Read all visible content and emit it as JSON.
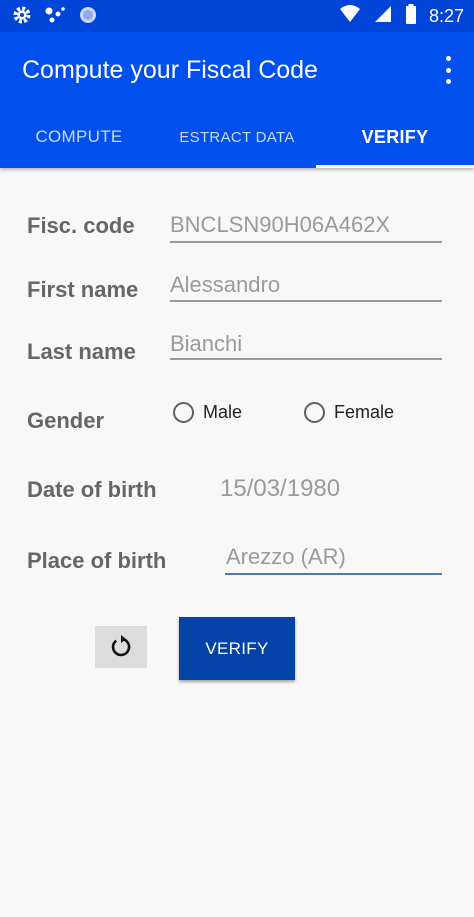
{
  "status_bar": {
    "time": "8:27"
  },
  "app_bar": {
    "title": "Compute your Fiscal Code"
  },
  "tabs": [
    {
      "label": "COMPUTE"
    },
    {
      "label": "ESTRACT DATA"
    },
    {
      "label": "VERIFY"
    }
  ],
  "form": {
    "fiscal_code": {
      "label": "Fisc. code",
      "value": "BNCLSN90H06A462X"
    },
    "first_name": {
      "label": "First name",
      "value": "Alessandro"
    },
    "last_name": {
      "label": "Last name",
      "value": "Bianchi"
    },
    "gender": {
      "label": "Gender",
      "options": [
        "Male",
        "Female"
      ]
    },
    "date_of_birth": {
      "label": "Date of birth",
      "value": "15/03/1980"
    },
    "place_of_birth": {
      "label": "Place of birth",
      "value": "Arezzo (AR)"
    }
  },
  "actions": {
    "verify_label": "VERIFY"
  },
  "colors": {
    "primary": "#0050ee",
    "status_bar": "#0045d8",
    "button": "#0343a8",
    "active_underline": "#4a78c8"
  }
}
